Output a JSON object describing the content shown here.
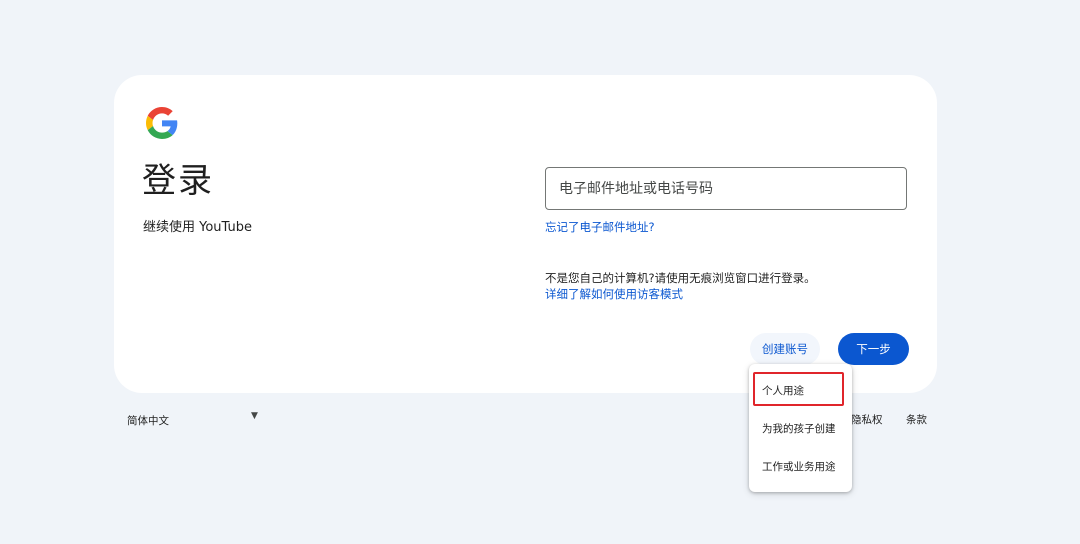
{
  "page": {
    "title": "登录",
    "subtitle": "继续使用 YouTube"
  },
  "email": {
    "placeholder": "电子邮件地址或电话号码",
    "value": ""
  },
  "links": {
    "forgot": "忘记了电子邮件地址?",
    "guest_mode": "详细了解如何使用访客模式"
  },
  "notice": "不是您自己的计算机?请使用无痕浏览窗口进行登录。",
  "buttons": {
    "create_account": "创建账号",
    "next": "下一步"
  },
  "create_menu": {
    "items": [
      {
        "label": "个人用途",
        "highlighted": true
      },
      {
        "label": "为我的孩子创建"
      },
      {
        "label": "工作或业务用途"
      }
    ]
  },
  "footer": {
    "language": "简体中文",
    "privacy": "隐私权",
    "terms": "条款"
  },
  "colors": {
    "accent": "#0b57d0",
    "background": "#f0f4f9",
    "highlight_border": "#e0252b",
    "google_blue": "#4285f4",
    "google_red": "#ea4335",
    "google_yellow": "#fbbc05",
    "google_green": "#34a853"
  },
  "icons": {
    "logo": "google-g-icon",
    "language_caret": "caret-down-icon"
  }
}
